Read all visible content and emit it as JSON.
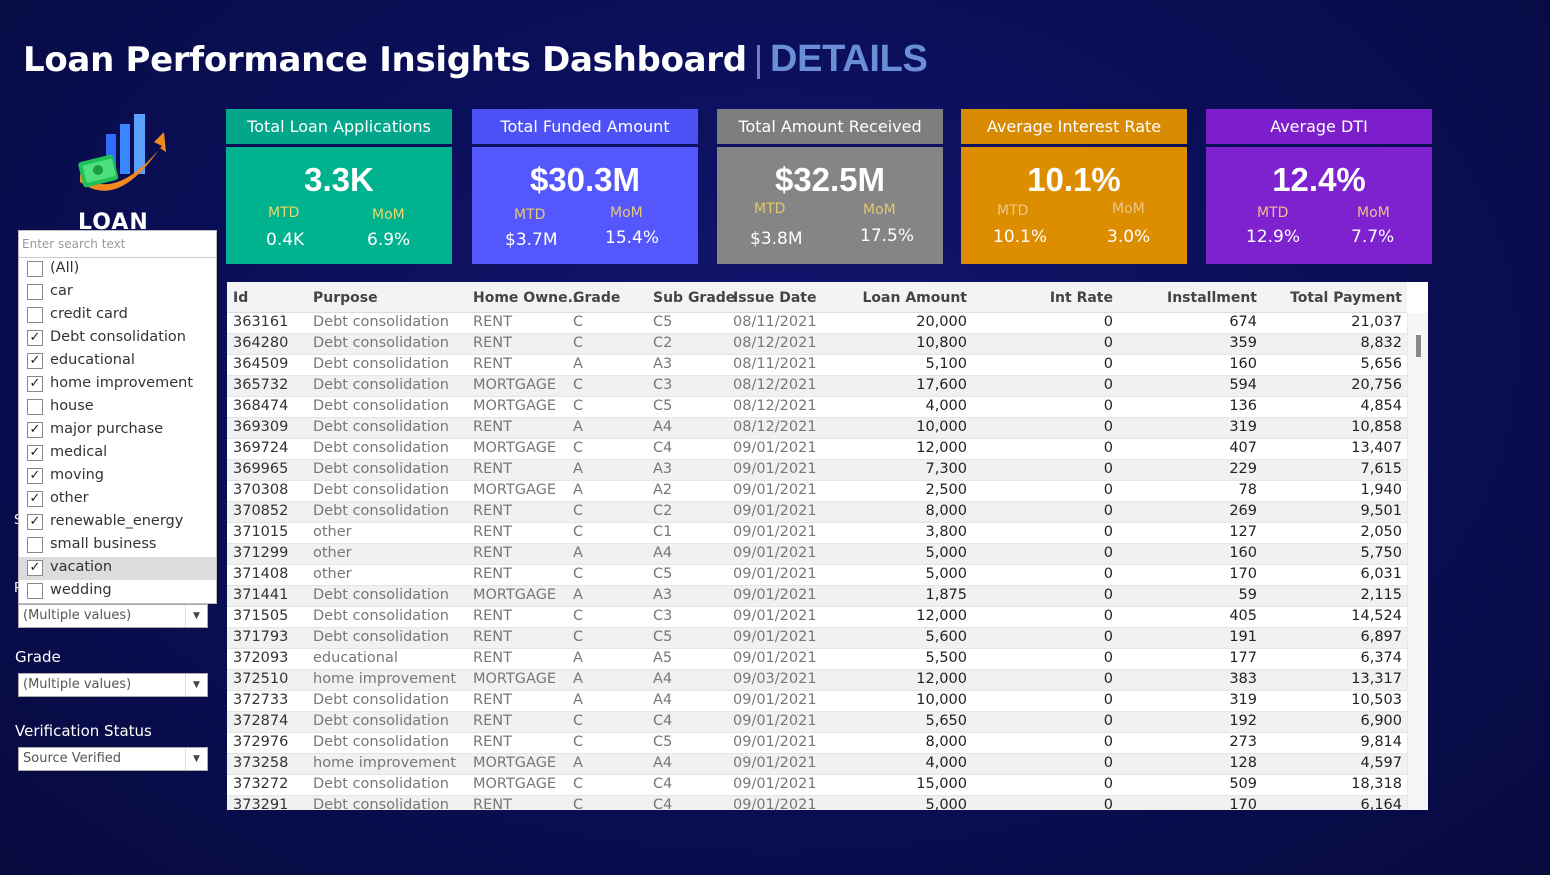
{
  "header": {
    "title": "Loan Performance Insights Dashboard",
    "separator": "|",
    "subtitle": "DETAILS"
  },
  "logo": {
    "text": "LOAN"
  },
  "kpis": [
    {
      "title": "Total Loan Applications",
      "value": "3.3K",
      "mtd_label": "MTD",
      "mom_label": "MoM",
      "mtd": "0.4K",
      "mom": "6.9%",
      "header_color": "#02a68a",
      "body_color": "#00b28e",
      "label_color": "#e7d86a"
    },
    {
      "title": "Total Funded Amount",
      "value": "$30.3M",
      "mtd_label": "MTD",
      "mom_label": "MoM",
      "mtd": "$3.7M",
      "mom": "15.4%",
      "header_color": "#4c52f6",
      "body_color": "#5457fb",
      "label_color": "#e7c77a"
    },
    {
      "title": "Total Amount Received",
      "value": "$32.5M",
      "mtd_label": "MTD",
      "mom_label": "MoM",
      "mtd": "$3.8M",
      "mom": "17.5%",
      "header_color": "#7e7e7e",
      "body_color": "#858585",
      "label_color": "#e4c76a"
    },
    {
      "title": "Average Interest Rate",
      "value": "10.1%",
      "mtd_label": "MTD",
      "mom_label": "MoM",
      "mtd": "10.1%",
      "mom": "3.0%",
      "header_color": "#d88a00",
      "body_color": "#dd8d00",
      "label_color": "#f1c48a"
    },
    {
      "title": "Average DTI",
      "value": "12.4%",
      "mtd_label": "MTD",
      "mom_label": "MoM",
      "mtd": "12.9%",
      "mom": "7.7%",
      "header_color": "#7c1ec9",
      "body_color": "#7e22d0",
      "label_color": "#e9c08e"
    }
  ],
  "filters": {
    "search_placeholder": "Enter search text",
    "purpose_options": [
      {
        "label": "(All)",
        "checked": false
      },
      {
        "label": "car",
        "checked": false
      },
      {
        "label": "credit card",
        "checked": false
      },
      {
        "label": "Debt consolidation",
        "checked": true
      },
      {
        "label": "educational",
        "checked": true
      },
      {
        "label": "home improvement",
        "checked": true
      },
      {
        "label": "house",
        "checked": false
      },
      {
        "label": "major purchase",
        "checked": true
      },
      {
        "label": "medical",
        "checked": true
      },
      {
        "label": "moving",
        "checked": true
      },
      {
        "label": "other",
        "checked": true
      },
      {
        "label": "renewable_energy",
        "checked": true
      },
      {
        "label": "small business",
        "checked": false
      },
      {
        "label": "vacation",
        "checked": true
      },
      {
        "label": "wedding",
        "checked": false
      }
    ],
    "purpose_value": "(Multiple values)",
    "grade_label": "Grade",
    "grade_value": "(Multiple values)",
    "verification_label": "Verification Status",
    "verification_value": "Source Verified"
  },
  "table": {
    "columns": [
      "Id",
      "Purpose",
      "Home Owne..",
      "Grade",
      "Sub Grade",
      "Issue Date",
      "Loan Amount",
      "Int Rate",
      "Installment",
      "Total Payment"
    ],
    "rows": [
      [
        "363161",
        "Debt consolidation",
        "RENT",
        "C",
        "C5",
        "08/11/2021",
        "20,000",
        "0",
        "674",
        "21,037"
      ],
      [
        "364280",
        "Debt consolidation",
        "RENT",
        "C",
        "C2",
        "08/12/2021",
        "10,800",
        "0",
        "359",
        "8,832"
      ],
      [
        "364509",
        "Debt consolidation",
        "RENT",
        "A",
        "A3",
        "08/11/2021",
        "5,100",
        "0",
        "160",
        "5,656"
      ],
      [
        "365732",
        "Debt consolidation",
        "MORTGAGE",
        "C",
        "C3",
        "08/12/2021",
        "17,600",
        "0",
        "594",
        "20,756"
      ],
      [
        "368474",
        "Debt consolidation",
        "MORTGAGE",
        "C",
        "C5",
        "08/12/2021",
        "4,000",
        "0",
        "136",
        "4,854"
      ],
      [
        "369309",
        "Debt consolidation",
        "RENT",
        "A",
        "A4",
        "08/12/2021",
        "10,000",
        "0",
        "319",
        "10,858"
      ],
      [
        "369724",
        "Debt consolidation",
        "MORTGAGE",
        "C",
        "C4",
        "09/01/2021",
        "12,000",
        "0",
        "407",
        "13,407"
      ],
      [
        "369965",
        "Debt consolidation",
        "RENT",
        "A",
        "A3",
        "09/01/2021",
        "7,300",
        "0",
        "229",
        "7,615"
      ],
      [
        "370308",
        "Debt consolidation",
        "MORTGAGE",
        "A",
        "A2",
        "09/01/2021",
        "2,500",
        "0",
        "78",
        "1,940"
      ],
      [
        "370852",
        "Debt consolidation",
        "RENT",
        "C",
        "C2",
        "09/01/2021",
        "8,000",
        "0",
        "269",
        "9,501"
      ],
      [
        "371015",
        "other",
        "RENT",
        "C",
        "C1",
        "09/01/2021",
        "3,800",
        "0",
        "127",
        "2,050"
      ],
      [
        "371299",
        "other",
        "RENT",
        "A",
        "A4",
        "09/01/2021",
        "5,000",
        "0",
        "160",
        "5,750"
      ],
      [
        "371408",
        "other",
        "RENT",
        "C",
        "C5",
        "09/01/2021",
        "5,000",
        "0",
        "170",
        "6,031"
      ],
      [
        "371441",
        "Debt consolidation",
        "MORTGAGE",
        "A",
        "A3",
        "09/01/2021",
        "1,875",
        "0",
        "59",
        "2,115"
      ],
      [
        "371505",
        "Debt consolidation",
        "RENT",
        "C",
        "C3",
        "09/01/2021",
        "12,000",
        "0",
        "405",
        "14,524"
      ],
      [
        "371793",
        "Debt consolidation",
        "RENT",
        "C",
        "C5",
        "09/01/2021",
        "5,600",
        "0",
        "191",
        "6,897"
      ],
      [
        "372093",
        "educational",
        "RENT",
        "A",
        "A5",
        "09/01/2021",
        "5,500",
        "0",
        "177",
        "6,374"
      ],
      [
        "372510",
        "home improvement",
        "MORTGAGE",
        "A",
        "A4",
        "09/03/2021",
        "12,000",
        "0",
        "383",
        "13,317"
      ],
      [
        "372733",
        "Debt consolidation",
        "RENT",
        "A",
        "A4",
        "09/01/2021",
        "10,000",
        "0",
        "319",
        "10,503"
      ],
      [
        "372874",
        "Debt consolidation",
        "RENT",
        "C",
        "C4",
        "09/01/2021",
        "5,650",
        "0",
        "192",
        "6,900"
      ],
      [
        "372976",
        "Debt consolidation",
        "RENT",
        "C",
        "C5",
        "09/01/2021",
        "8,000",
        "0",
        "273",
        "9,814"
      ],
      [
        "373258",
        "home improvement",
        "MORTGAGE",
        "A",
        "A4",
        "09/01/2021",
        "4,000",
        "0",
        "128",
        "4,597"
      ],
      [
        "373272",
        "Debt consolidation",
        "MORTGAGE",
        "C",
        "C4",
        "09/01/2021",
        "15,000",
        "0",
        "509",
        "18,318"
      ],
      [
        "373291",
        "Debt consolidation",
        "RENT",
        "C",
        "C4",
        "09/01/2021",
        "5,000",
        "0",
        "170",
        "6,164"
      ]
    ]
  }
}
